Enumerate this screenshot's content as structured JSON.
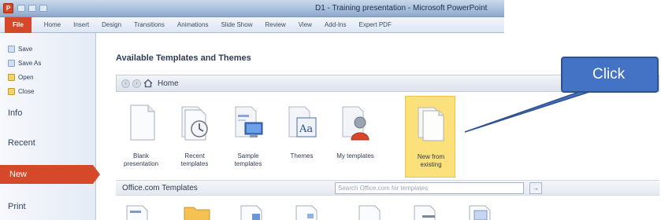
{
  "window": {
    "app_icon_letter": "P",
    "title": "D1 - Training presentation - Microsoft PowerPoint"
  },
  "ribbon": {
    "tabs": [
      "File",
      "Home",
      "Insert",
      "Design",
      "Transitions",
      "Animations",
      "Slide Show",
      "Review",
      "View",
      "Add-Ins",
      "Expert PDF"
    ]
  },
  "backstage_nav": {
    "small_items": [
      {
        "label": "Save",
        "icon": "save-icon"
      },
      {
        "label": "Save As",
        "icon": "save-as-icon"
      },
      {
        "label": "Open",
        "icon": "open-folder-icon"
      },
      {
        "label": "Close",
        "icon": "close-folder-icon"
      }
    ],
    "big_items": [
      "Info",
      "Recent",
      "New",
      "Print"
    ],
    "selected": "New"
  },
  "main": {
    "section_title": "Available Templates and Themes",
    "breadcrumb": {
      "back": "‹",
      "forward": "›",
      "home_label": "Home"
    },
    "templates": [
      {
        "line1": "Blank",
        "line2": "presentation",
        "icon": "blank-page-icon"
      },
      {
        "line1": "Recent",
        "line2": "templates",
        "icon": "recent-clock-icon"
      },
      {
        "line1": "Sample",
        "line2": "templates",
        "icon": "sample-monitor-icon"
      },
      {
        "line1": "Themes",
        "line2": "",
        "icon": "themes-aa-icon"
      },
      {
        "line1": "My templates",
        "line2": "",
        "icon": "my-templates-person-icon"
      },
      {
        "line1": "New from",
        "line2": "existing",
        "icon": "new-from-existing-icon"
      }
    ],
    "selected_template": "New from existing",
    "officecom": {
      "label": "Office.com Templates",
      "search_placeholder": "Search Office.com for templates",
      "go": "→"
    }
  },
  "callout": {
    "text": "Click",
    "fill": "#4472c4",
    "border": "#2f528f"
  },
  "colors": {
    "file_tab": "#d5492a",
    "selected_tile": "#fbe07c",
    "pointer_line": "#2f528f"
  }
}
